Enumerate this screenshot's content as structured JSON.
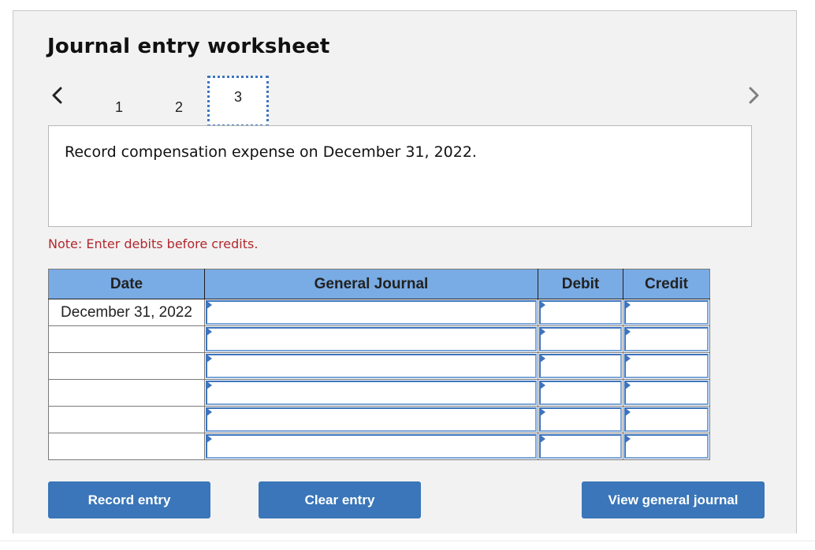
{
  "page": {
    "title": "Journal entry worksheet"
  },
  "navigation": {
    "prev_icon": "chevron-left-icon",
    "next_icon": "chevron-right-icon",
    "steps": [
      {
        "label": "1",
        "active": false
      },
      {
        "label": "2",
        "active": false
      },
      {
        "label": "3",
        "active": true
      }
    ]
  },
  "prompt": {
    "text": "Record compensation expense on December 31, 2022."
  },
  "note": {
    "text": "Note: Enter debits before credits."
  },
  "journal": {
    "headers": {
      "date": "Date",
      "general_journal": "General Journal",
      "debit": "Debit",
      "credit": "Credit"
    },
    "rows": [
      {
        "date": "December 31, 2022",
        "account": "",
        "debit": "",
        "credit": ""
      },
      {
        "date": "",
        "account": "",
        "debit": "",
        "credit": ""
      },
      {
        "date": "",
        "account": "",
        "debit": "",
        "credit": ""
      },
      {
        "date": "",
        "account": "",
        "debit": "",
        "credit": ""
      },
      {
        "date": "",
        "account": "",
        "debit": "",
        "credit": ""
      },
      {
        "date": "",
        "account": "",
        "debit": "",
        "credit": ""
      }
    ]
  },
  "buttons": {
    "record": "Record entry",
    "clear": "Clear entry",
    "view": "View general journal"
  },
  "colors": {
    "header_bg": "#79abe4",
    "button_bg": "#3a76b9",
    "note_text": "#b3282d",
    "focus_outline": "#3d74bd"
  }
}
